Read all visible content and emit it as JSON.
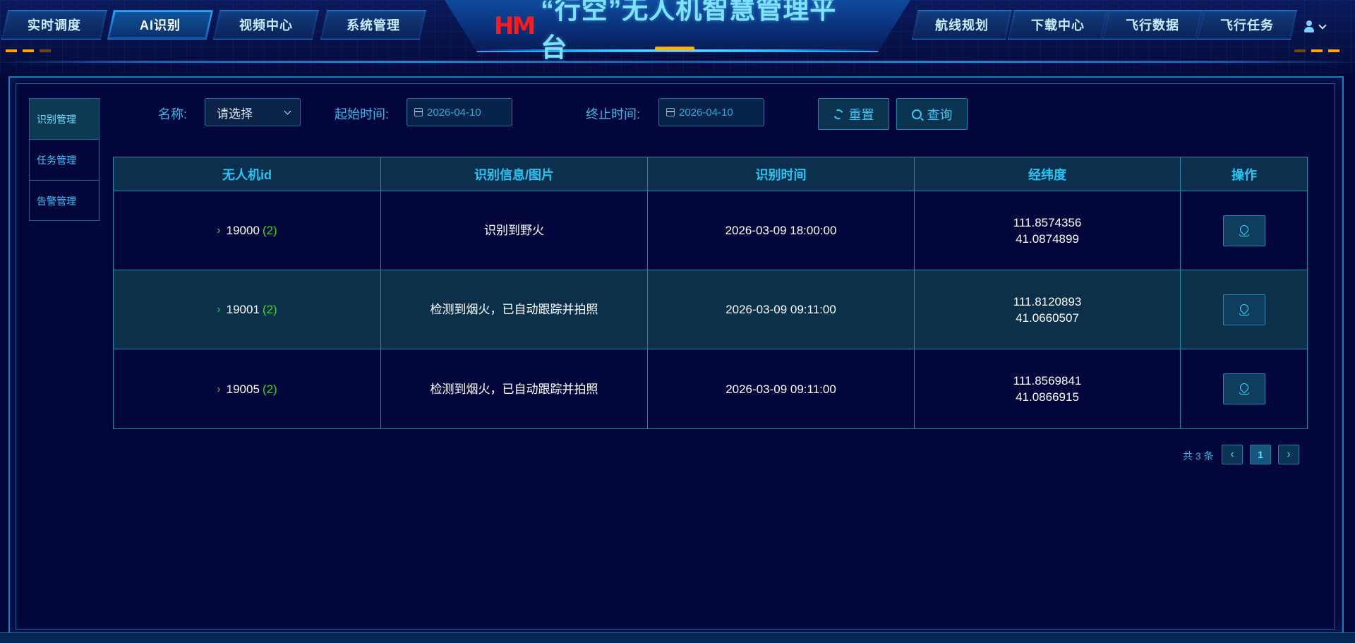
{
  "app": {
    "logo_text": "HM",
    "title": "“行空”无人机智慧管理平台"
  },
  "nav_left": [
    {
      "label": "实时调度",
      "active": false
    },
    {
      "label": "AI识别",
      "active": true
    },
    {
      "label": "视频中心",
      "active": false
    },
    {
      "label": "系统管理",
      "active": false
    }
  ],
  "nav_right": [
    {
      "label": "航线规划"
    },
    {
      "label": "下载中心"
    },
    {
      "label": "飞行数据"
    },
    {
      "label": "飞行任务"
    }
  ],
  "side_menu": [
    {
      "label": "识别管理",
      "active": true
    },
    {
      "label": "任务管理",
      "active": false
    },
    {
      "label": "告警管理",
      "active": false
    }
  ],
  "filters": {
    "name_label": "名称:",
    "name_select_value": "请选择",
    "start_label": "起始时间:",
    "start_value": "2026-04-10",
    "end_label": "终止时间:",
    "end_value": "2026-04-10",
    "reset_label": "重置",
    "query_label": "查询"
  },
  "table": {
    "columns": [
      "无人机id",
      "识别信息/图片",
      "识别时间",
      "经纬度",
      "操作"
    ],
    "rows": [
      {
        "id": "19000",
        "count": "(2)",
        "info": "识别到野火",
        "time": "2026-03-09 18:00:00",
        "lng": "111.8574356",
        "lat": "41.0874899"
      },
      {
        "id": "19001",
        "count": "(2)",
        "info": "检测到烟火，已自动跟踪并拍照",
        "time": "2026-03-09 09:11:00",
        "lng": "111.8120893",
        "lat": "41.0660507"
      },
      {
        "id": "19005",
        "count": "(2)",
        "info": "检测到烟火，已自动跟踪并拍照",
        "time": "2026-03-09 09:11:00",
        "lng": "111.8569841",
        "lat": "41.0866915"
      }
    ]
  },
  "pagination": {
    "total_text": "共 3 条",
    "prev": "‹",
    "current_page": "1",
    "next": "›"
  },
  "icons": {
    "expand": "chevron-right-icon",
    "user": "user-icon",
    "location": "location-pin-icon",
    "calendar": "calendar-icon",
    "refresh": "refresh-icon",
    "search": "search-icon"
  },
  "colors": {
    "background": "#03063a",
    "accent": "#24c6f5",
    "title": "#7fe3ff",
    "logo": "#ff1a1a",
    "count_green": "#23e21f",
    "orange_accent": "#ffa400"
  }
}
